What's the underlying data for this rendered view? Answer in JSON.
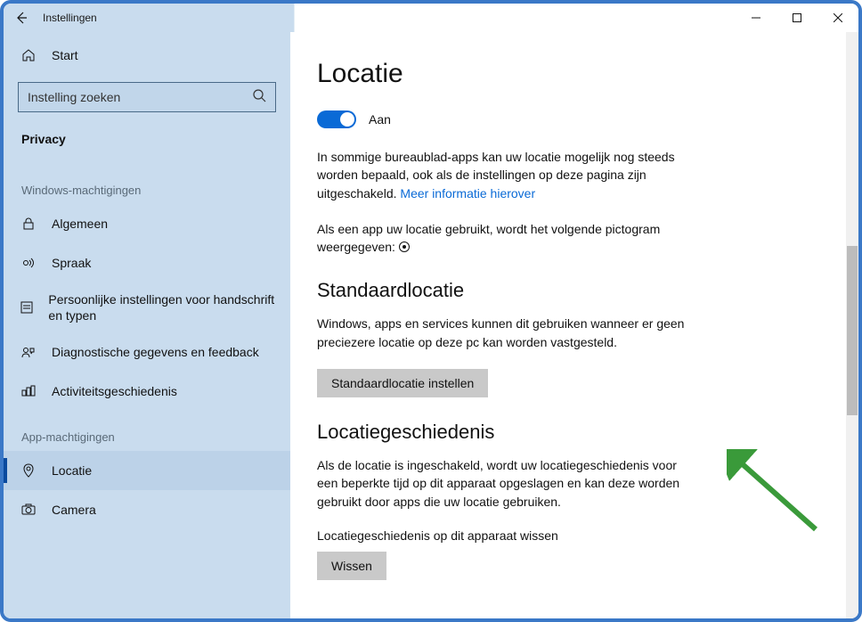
{
  "titlebar": {
    "title": "Instellingen"
  },
  "sidebar": {
    "home_label": "Start",
    "search_placeholder": "Instelling zoeken",
    "category_label": "Privacy",
    "group1_label": "Windows-machtigingen",
    "group2_label": "App-machtigingen",
    "items_perms": [
      {
        "label": "Algemeen"
      },
      {
        "label": "Spraak"
      },
      {
        "label": "Persoonlijke instellingen voor handschrift en typen"
      },
      {
        "label": "Diagnostische gegevens en feedback"
      },
      {
        "label": "Activiteitsgeschiedenis"
      }
    ],
    "items_app": [
      {
        "label": "Locatie",
        "active": true
      },
      {
        "label": "Camera"
      }
    ]
  },
  "content": {
    "heading": "Locatie",
    "toggle_label": "Aan",
    "para1_text": "In sommige bureaublad-apps kan uw locatie mogelijk nog steeds worden bepaald, ook als de instellingen op deze pagina zijn uitgeschakeld. ",
    "para1_link": "Meer informatie hierover",
    "para2_text": "Als een app uw locatie gebruikt, wordt het volgende pictogram weergegeven: ",
    "section_default_heading": "Standaardlocatie",
    "section_default_para": "Windows, apps en services kunnen dit gebruiken wanneer er geen preciezere locatie op deze pc kan worden vastgesteld.",
    "btn_set_default": "Standaardlocatie instellen",
    "section_history_heading": "Locatiegeschiedenis",
    "section_history_para": "Als de locatie is ingeschakeld, wordt uw locatiegeschiedenis voor een beperkte tijd op dit apparaat opgeslagen en kan deze worden gebruikt door apps die uw locatie gebruiken.",
    "clear_label": "Locatiegeschiedenis op dit apparaat wissen",
    "btn_clear": "Wissen"
  }
}
